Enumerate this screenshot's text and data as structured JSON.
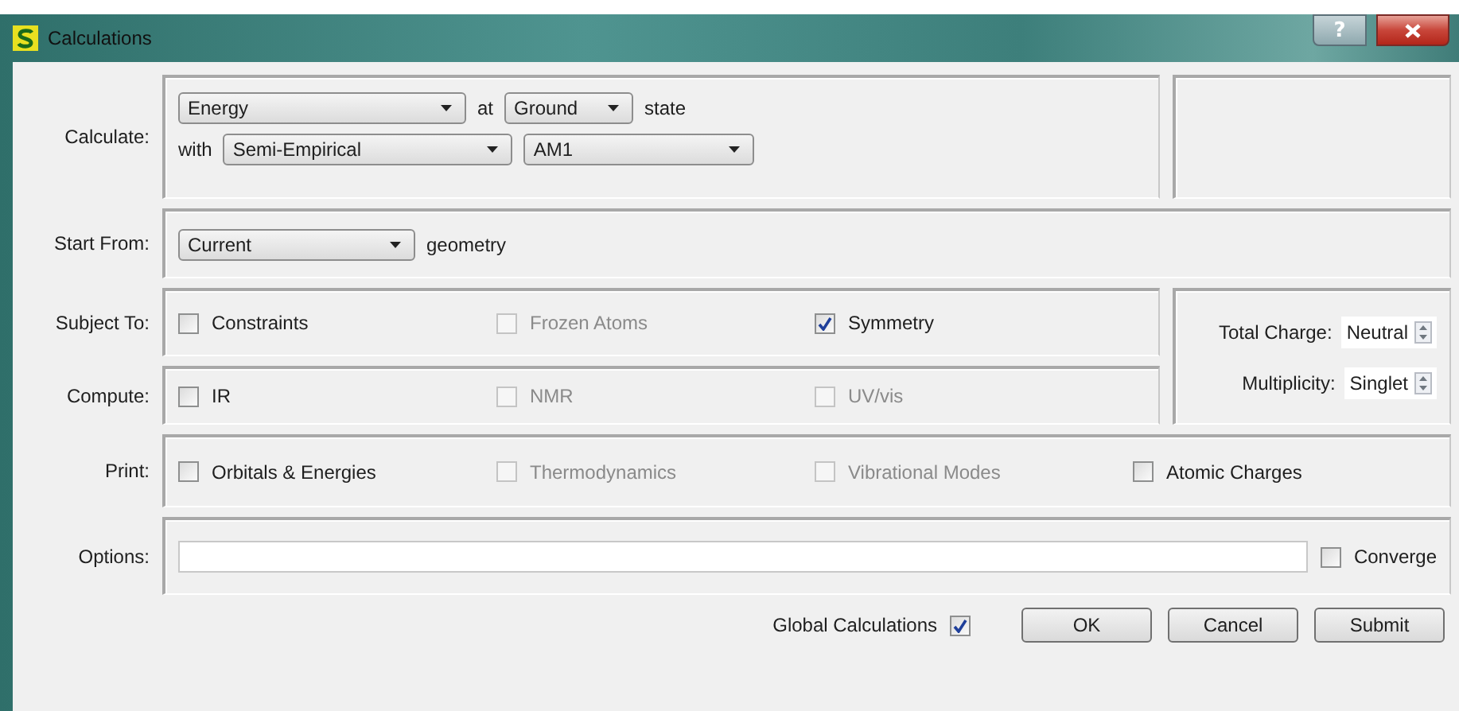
{
  "window": {
    "title": "Calculations",
    "help_button": "?"
  },
  "calculate": {
    "label": "Calculate:",
    "task": "Energy",
    "at": "at",
    "state": "Ground",
    "state_suffix": "state",
    "with": "with",
    "method": "Semi-Empirical",
    "model": "AM1"
  },
  "start_from": {
    "label": "Start From:",
    "value": "Current",
    "suffix": "geometry"
  },
  "subject_to": {
    "label": "Subject To:",
    "options": [
      {
        "label": "Constraints",
        "checked": false,
        "disabled": false
      },
      {
        "label": "Frozen Atoms",
        "checked": false,
        "disabled": true
      },
      {
        "label": "Symmetry",
        "checked": true,
        "disabled": false
      }
    ]
  },
  "compute": {
    "label": "Compute:",
    "options": [
      {
        "label": "IR",
        "checked": false,
        "disabled": false
      },
      {
        "label": "NMR",
        "checked": false,
        "disabled": true
      },
      {
        "label": "UV/vis",
        "checked": false,
        "disabled": true
      }
    ]
  },
  "charge": {
    "label": "Total Charge:",
    "value": "Neutral"
  },
  "multiplicity": {
    "label": "Multiplicity:",
    "value": "Singlet"
  },
  "print": {
    "label": "Print:",
    "options": [
      {
        "label": "Orbitals & Energies",
        "checked": false,
        "disabled": false
      },
      {
        "label": "Thermodynamics",
        "checked": false,
        "disabled": true
      },
      {
        "label": "Vibrational Modes",
        "checked": false,
        "disabled": true
      },
      {
        "label": "Atomic Charges",
        "checked": false,
        "disabled": false
      }
    ]
  },
  "options": {
    "label": "Options:",
    "converge": {
      "label": "Converge",
      "checked": false,
      "disabled": false
    }
  },
  "footer": {
    "global": {
      "label": "Global Calculations",
      "checked": true,
      "disabled": false
    },
    "buttons": [
      "OK",
      "Cancel",
      "Submit"
    ]
  }
}
